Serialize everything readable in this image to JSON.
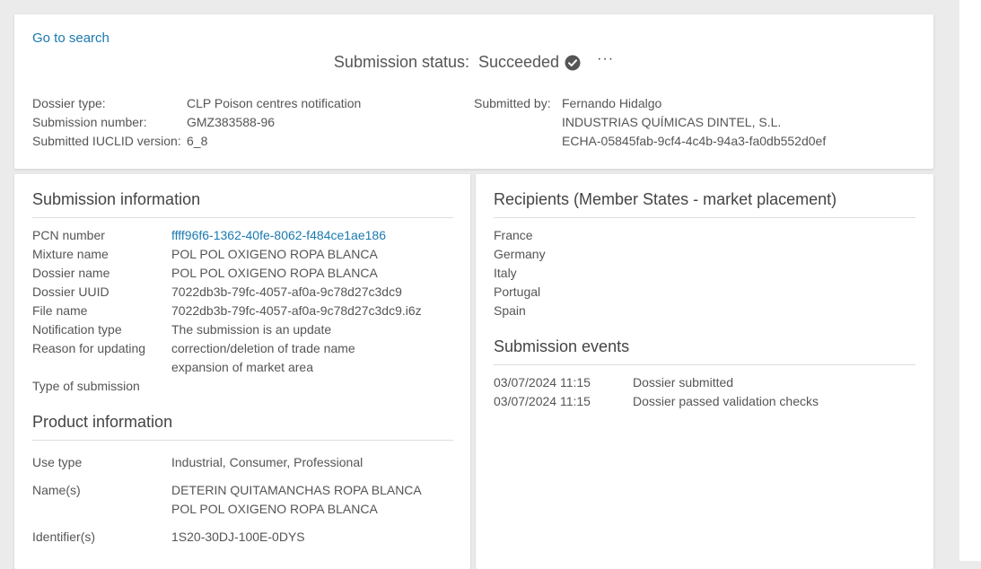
{
  "nav": {
    "go_to_search": "Go to search"
  },
  "status": {
    "label": "Submission status:",
    "value": "Succeeded",
    "more": "···"
  },
  "dossier": {
    "type_label": "Dossier type:",
    "type_value": "CLP Poison centres notification",
    "number_label": "Submission number:",
    "number_value": "GMZ383588-96",
    "iuclid_label": "Submitted IUCLID version:",
    "iuclid_value": "6_8"
  },
  "submitter": {
    "label": "Submitted by:",
    "name": "Fernando Hidalgo",
    "company": "INDUSTRIAS QUÍMICAS DINTEL, S.L.",
    "id": "ECHA-05845fab-9cf4-4c4b-94a3-fa0db552d0ef"
  },
  "submission_info": {
    "title": "Submission information",
    "pcn_label": "PCN number",
    "pcn_value": "ffff96f6-1362-40fe-8062-f484ce1ae186",
    "mixture_label": "Mixture name",
    "mixture_value": "POL POL OXIGENO ROPA BLANCA",
    "dossier_name_label": "Dossier name",
    "dossier_name_value": "POL POL OXIGENO ROPA BLANCA",
    "uuid_label": "Dossier UUID",
    "uuid_value": "7022db3b-79fc-4057-af0a-9c78d27c3dc9",
    "file_label": "File name",
    "file_value": "7022db3b-79fc-4057-af0a-9c78d27c3dc9.i6z",
    "notification_label": "Notification type",
    "notification_value": "The submission is an update",
    "reason_label": "Reason for updating",
    "reason_value_1": "correction/deletion of trade name",
    "reason_value_2": "expansion of market area",
    "type_label": "Type of submission"
  },
  "product_info": {
    "title": "Product information",
    "use_label": "Use type",
    "use_value": "Industrial, Consumer, Professional",
    "names_label": "Name(s)",
    "name_1": "DETERIN QUITAMANCHAS ROPA BLANCA",
    "name_2": "POL POL OXIGENO ROPA BLANCA",
    "identifier_label": "Identifier(s)",
    "identifier_value": "1S20-30DJ-100E-0DYS"
  },
  "recipients": {
    "title": "Recipients (Member States - market placement)",
    "countries": [
      "France",
      "Germany",
      "Italy",
      "Portugal",
      "Spain"
    ]
  },
  "events": {
    "title": "Submission events",
    "items": [
      {
        "time": "03/07/2024 11:15",
        "text": "Dossier submitted"
      },
      {
        "time": "03/07/2024 11:15",
        "text": "Dossier passed validation checks"
      }
    ]
  },
  "colors": {
    "link": "#1a7ab0",
    "check": "#555555"
  },
  "icons": {
    "status": "check-circle-icon",
    "more": "more-horizontal-icon"
  }
}
